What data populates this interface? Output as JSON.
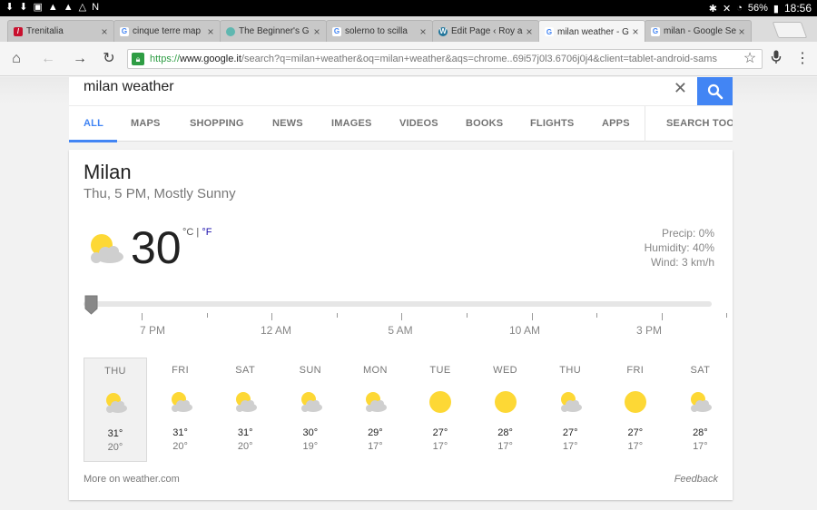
{
  "status_bar": {
    "left_icons": [
      "download-icon",
      "download-icon",
      "screenshot-icon",
      "warning-icon",
      "warning-icon",
      "drive-icon",
      "nfc-icon"
    ],
    "battery": "56%",
    "time": "18:56"
  },
  "tabs": [
    {
      "label": "Trenitalia",
      "favicon": "trenitalia"
    },
    {
      "label": "cinque terre map",
      "favicon": "G"
    },
    {
      "label": "The Beginner's G",
      "favicon": "teal"
    },
    {
      "label": "solerno to scilla",
      "favicon": "G"
    },
    {
      "label": "Edit Page ‹ Roy a",
      "favicon": "W"
    },
    {
      "label": "milan weather - G",
      "favicon": "G"
    },
    {
      "label": "milan - Google Se",
      "favicon": "G"
    }
  ],
  "toolbar": {
    "url_scheme": "https://",
    "url_host": "www.google.it",
    "url_rest": "/search?q=milan+weather&oq=milan+weather&aqs=chrome..69i57j0l3.6706j0j4&client=tablet-android-sams"
  },
  "search": {
    "query": "milan weather"
  },
  "nav_tabs": [
    "ALL",
    "MAPS",
    "SHOPPING",
    "NEWS",
    "IMAGES",
    "VIDEOS",
    "BOOKS",
    "FLIGHTS",
    "APPS",
    "SEARCH TOO"
  ],
  "weather": {
    "city": "Milan",
    "subtitle": "Thu, 5 PM, Mostly Sunny",
    "temperature": "30",
    "unit_c": "°C",
    "unit_sep": "|",
    "unit_f": "°F",
    "precip": "Precip: 0%",
    "humidity": "Humidity: 40%",
    "wind": "Wind: 3 km/h",
    "current_icon": "partly-cloudy",
    "timeline_labels": [
      "7 PM",
      "12 AM",
      "5 AM",
      "10 AM",
      "3 PM"
    ],
    "forecast": [
      {
        "day": "THU",
        "hi": "31°",
        "lo": "20°",
        "icon": "partly-cloudy",
        "selected": true
      },
      {
        "day": "FRI",
        "hi": "31°",
        "lo": "20°",
        "icon": "partly-cloudy"
      },
      {
        "day": "SAT",
        "hi": "31°",
        "lo": "20°",
        "icon": "partly-cloudy"
      },
      {
        "day": "SUN",
        "hi": "30°",
        "lo": "19°",
        "icon": "partly-cloudy"
      },
      {
        "day": "MON",
        "hi": "29°",
        "lo": "17°",
        "icon": "partly-cloudy"
      },
      {
        "day": "TUE",
        "hi": "27°",
        "lo": "17°",
        "icon": "sunny"
      },
      {
        "day": "WED",
        "hi": "28°",
        "lo": "17°",
        "icon": "sunny"
      },
      {
        "day": "THU",
        "hi": "27°",
        "lo": "17°",
        "icon": "partly-cloudy"
      },
      {
        "day": "FRI",
        "hi": "27°",
        "lo": "17°",
        "icon": "sunny"
      },
      {
        "day": "SAT",
        "hi": "28°",
        "lo": "17°",
        "icon": "partly-cloudy"
      }
    ],
    "more_link": "More on weather.com",
    "feedback": "Feedback"
  },
  "colors": {
    "accent": "#4285f4",
    "sun": "#fdd835",
    "cloud": "#c8c8c8",
    "secure": "#2e9d44"
  }
}
